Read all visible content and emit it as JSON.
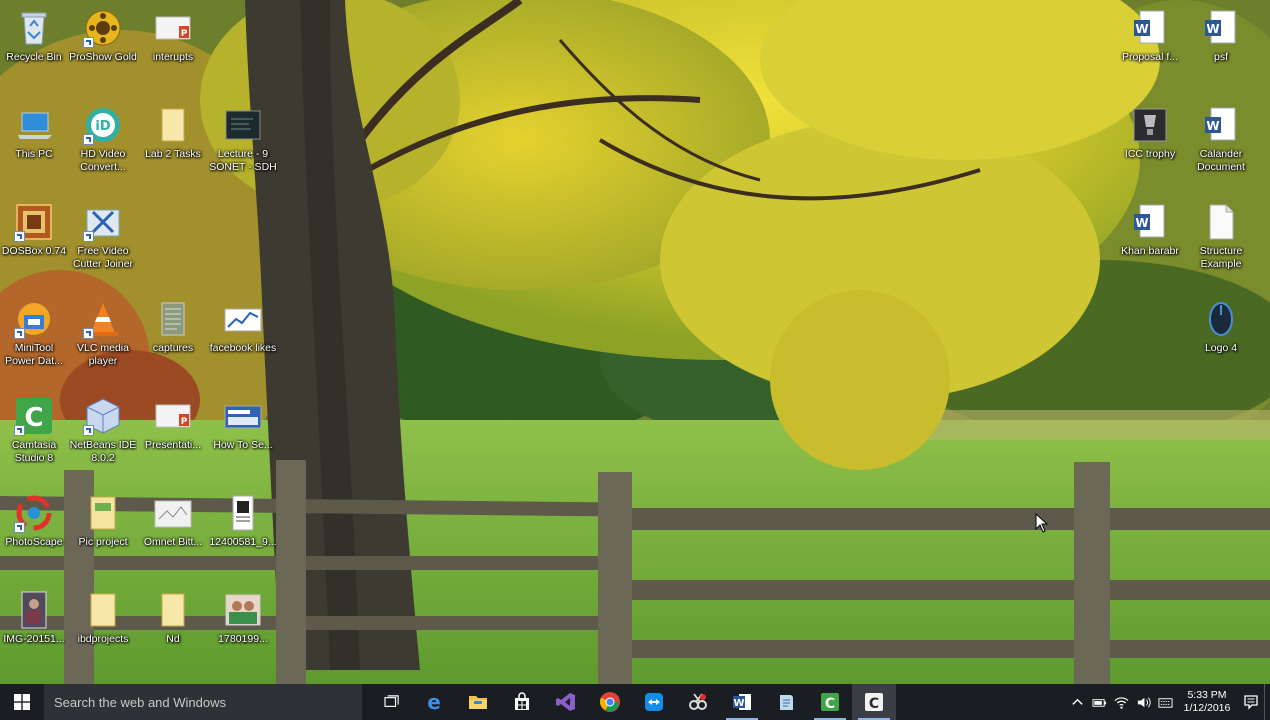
{
  "desktop": {
    "icons": [
      {
        "label": "Recycle Bin",
        "icon": "recycle-bin-icon"
      },
      {
        "label": "ProShow Gold",
        "icon": "proshow-gold-icon"
      },
      {
        "label": "interupts",
        "icon": "powerpoint-file-icon"
      },
      {
        "label": "This PC",
        "icon": "this-pc-icon"
      },
      {
        "label": "HD Video Convert...",
        "icon": "hd-video-converter-icon"
      },
      {
        "label": "Lab 2 Tasks",
        "icon": "folder-icon"
      },
      {
        "label": "Lecture - 9 SONET - SDH",
        "icon": "video-file-icon"
      },
      {
        "label": "DOSBox 0.74",
        "icon": "dosbox-icon"
      },
      {
        "label": "Free Video Cutter Joiner",
        "icon": "video-cutter-icon"
      },
      {
        "label": "MiniTool Power Dat...",
        "icon": "minitool-icon"
      },
      {
        "label": "VLC media player",
        "icon": "vlc-icon"
      },
      {
        "label": "captures",
        "icon": "text-document-icon"
      },
      {
        "label": "facebook likes",
        "icon": "chart-image-icon"
      },
      {
        "label": "Camtasia Studio 8",
        "icon": "camtasia-icon"
      },
      {
        "label": "NetBeans IDE 8.0.2",
        "icon": "netbeans-icon"
      },
      {
        "label": "Presentati...",
        "icon": "powerpoint-file-icon"
      },
      {
        "label": "How To Se...",
        "icon": "webpage-image-icon"
      },
      {
        "label": "PhotoScape",
        "icon": "photoscape-icon"
      },
      {
        "label": "Pic project",
        "icon": "folder-icon"
      },
      {
        "label": "Omnet Bitt...",
        "icon": "image-file-icon"
      },
      {
        "label": "12400581_9...",
        "icon": "image-file-icon"
      },
      {
        "label": "IMG-20151...",
        "icon": "photo-file-icon"
      },
      {
        "label": "ibdprojects",
        "icon": "folder-icon"
      },
      {
        "label": "Nd",
        "icon": "folder-icon"
      },
      {
        "label": "1780199...",
        "icon": "photo-file-icon"
      },
      {
        "label": "Proposal f...",
        "icon": "word-document-icon"
      },
      {
        "label": "psf",
        "icon": "word-document-icon"
      },
      {
        "label": "ICC trophy",
        "icon": "trophy-image-icon"
      },
      {
        "label": "Calander Document",
        "icon": "word-document-icon"
      },
      {
        "label": "Khan barabr",
        "icon": "word-document-icon"
      },
      {
        "label": "Structure Example",
        "icon": "blank-file-icon"
      },
      {
        "label": "Logo 4",
        "icon": "mouse-logo-icon"
      }
    ]
  },
  "taskbar": {
    "search_placeholder": "Search the web and Windows",
    "apps": [
      {
        "name": "Microsoft Edge",
        "icon": "edge-icon"
      },
      {
        "name": "File Explorer",
        "icon": "file-explorer-icon"
      },
      {
        "name": "Store",
        "icon": "store-icon"
      },
      {
        "name": "Visual Studio",
        "icon": "visual-studio-icon"
      },
      {
        "name": "Google Chrome",
        "icon": "chrome-icon"
      },
      {
        "name": "TeamViewer",
        "icon": "teamviewer-icon"
      },
      {
        "name": "Snipping",
        "icon": "snipping-icon"
      },
      {
        "name": "Word",
        "icon": "word-icon"
      },
      {
        "name": "Notepad",
        "icon": "notepad-icon"
      },
      {
        "name": "Camtasia Studio",
        "icon": "camtasia-icon"
      },
      {
        "name": "Camtasia Recorder",
        "icon": "camtasia-recorder-icon"
      }
    ],
    "clock_time": "5:33 PM",
    "clock_date": "1/12/2016"
  },
  "colors": {
    "taskbar_bg": "#1a1d21",
    "search_bg": "#2e3136",
    "running_indicator": "#8fb5e6"
  }
}
